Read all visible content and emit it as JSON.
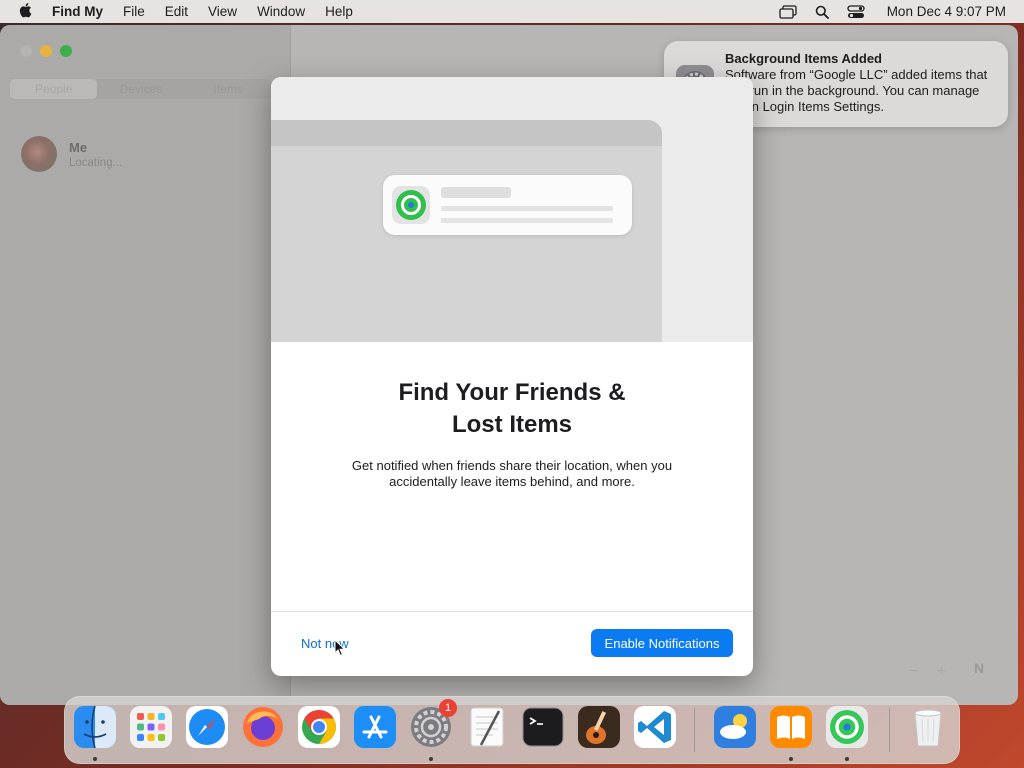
{
  "menubar": {
    "app_name": "Find My",
    "menus": [
      "File",
      "Edit",
      "View",
      "Window",
      "Help"
    ],
    "clock": "Mon Dec 4  9:07 PM"
  },
  "window": {
    "tabs": [
      "People",
      "Devices",
      "Items"
    ],
    "selected_tab": "People",
    "person": {
      "name": "Me",
      "status": "Locating..."
    },
    "map_controls": {
      "zoom_out": "−",
      "zoom_in": "+",
      "compass": "N"
    }
  },
  "notification": {
    "title": "Background Items Added",
    "body": "Software from “Google LLC” added items that can run in the background. You can manage this in Login Items Settings."
  },
  "dialog": {
    "title_line1": "Find Your Friends &",
    "title_line2": "Lost Items",
    "body": "Get notified when friends share their location, when you accidentally leave items behind, and more.",
    "secondary_button": "Not now",
    "primary_button": "Enable Notifications"
  },
  "dock": {
    "items": [
      {
        "name": "Finder",
        "icon": "finder-icon",
        "running": true
      },
      {
        "name": "Launchpad",
        "icon": "launchpad-icon",
        "running": false
      },
      {
        "name": "Safari",
        "icon": "safari-icon",
        "running": false
      },
      {
        "name": "Firefox",
        "icon": "firefox-icon",
        "running": false
      },
      {
        "name": "Google Chrome",
        "icon": "chrome-icon",
        "running": false
      },
      {
        "name": "App Store",
        "icon": "app-store-icon",
        "running": false
      },
      {
        "name": "System Settings",
        "icon": "system-settings-icon",
        "running": true,
        "badge": "1"
      },
      {
        "name": "TextEdit",
        "icon": "textedit-icon",
        "running": false
      },
      {
        "name": "Terminal",
        "icon": "terminal-icon",
        "running": false
      },
      {
        "name": "GarageBand",
        "icon": "garageband-icon",
        "running": false
      },
      {
        "name": "Visual Studio Code",
        "icon": "vscode-icon",
        "running": false
      },
      {
        "name": "Weather",
        "icon": "weather-icon",
        "running": false
      },
      {
        "name": "Books",
        "icon": "books-icon",
        "running": true
      },
      {
        "name": "Find My",
        "icon": "find-my-icon",
        "running": true
      },
      {
        "name": "Trash",
        "icon": "trash-icon",
        "running": false
      }
    ]
  },
  "colors": {
    "accent": "#0a7bf0",
    "link": "#0a6fd6",
    "badge": "#e94235"
  }
}
